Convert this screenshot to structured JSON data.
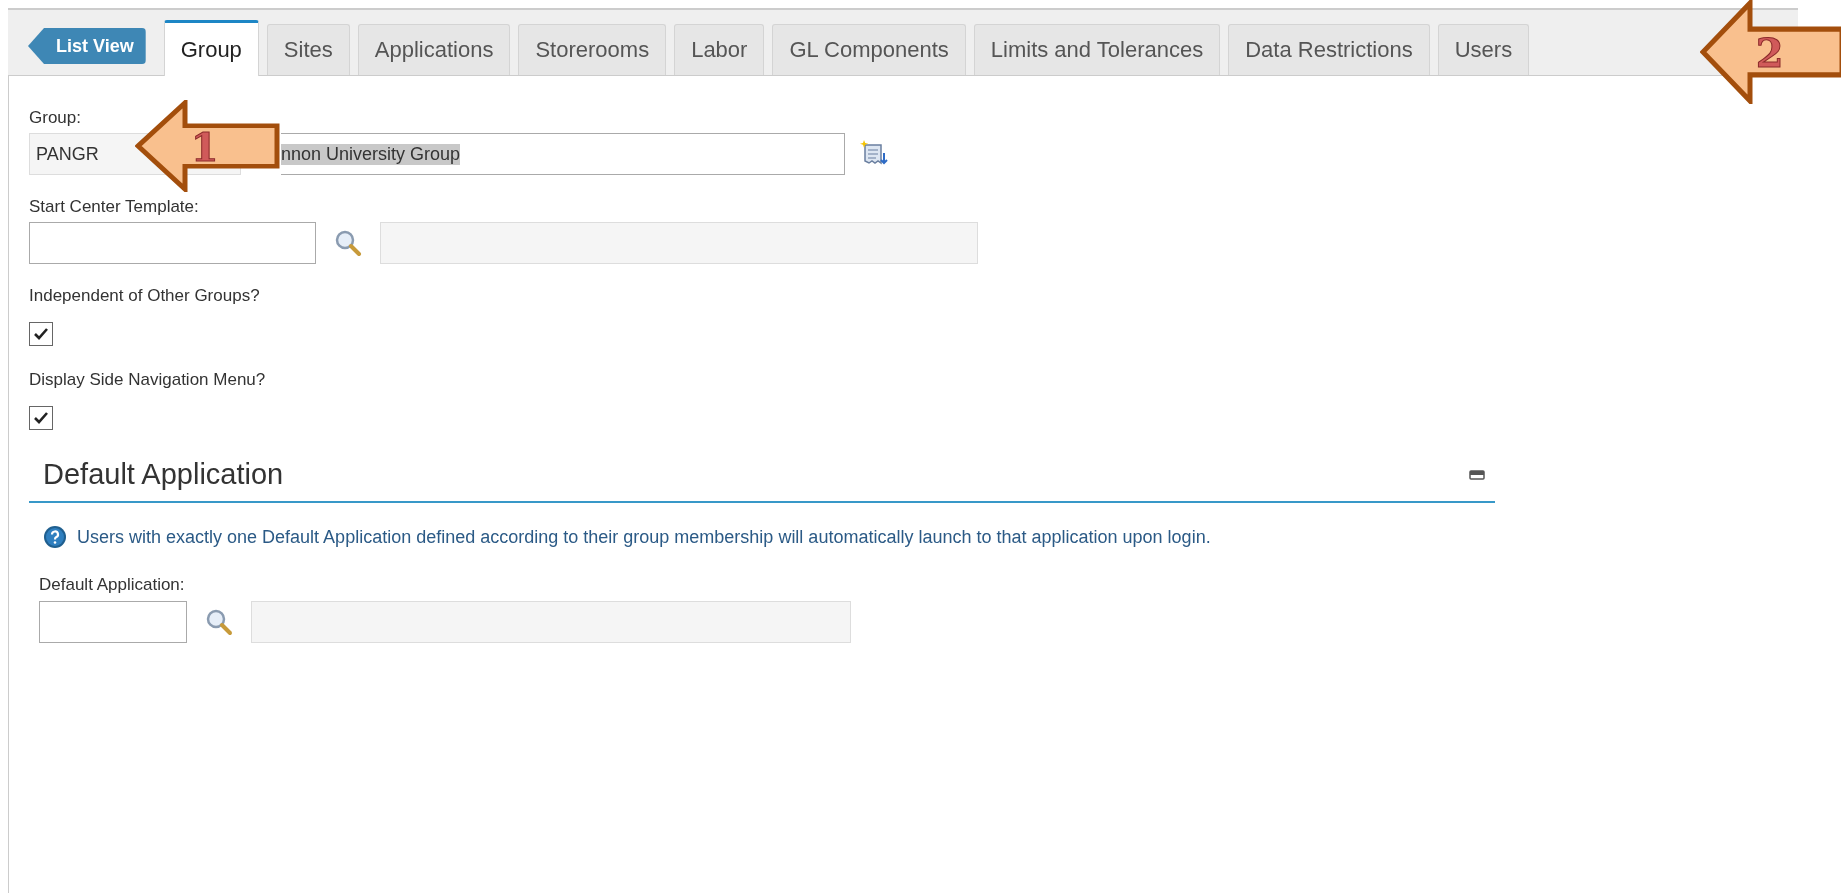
{
  "list_view_button": "List View",
  "tabs": [
    {
      "label": "Group",
      "selected": true
    },
    {
      "label": "Sites",
      "selected": false
    },
    {
      "label": "Applications",
      "selected": false
    },
    {
      "label": "Storerooms",
      "selected": false
    },
    {
      "label": "Labor",
      "selected": false
    },
    {
      "label": "GL Components",
      "selected": false
    },
    {
      "label": "Limits and Tolerances",
      "selected": false
    },
    {
      "label": "Data Restrictions",
      "selected": false
    },
    {
      "label": "Users",
      "selected": false
    }
  ],
  "group": {
    "label": "Group:",
    "value": "PANGR",
    "description": "nnon University Group"
  },
  "start_center_template": {
    "label": "Start Center Template:"
  },
  "checkboxes": [
    {
      "label": "Independent of Other Groups?",
      "checked": true
    },
    {
      "label": "Display Side Navigation Menu?",
      "checked": true
    }
  ],
  "section": {
    "title": "Default Application",
    "info": "Users with exactly one Default Application defined according to their group membership will automatically launch to that application upon login.",
    "field_label": "Default Application:"
  },
  "callouts": [
    {
      "number": "1"
    },
    {
      "number": "2"
    }
  ]
}
